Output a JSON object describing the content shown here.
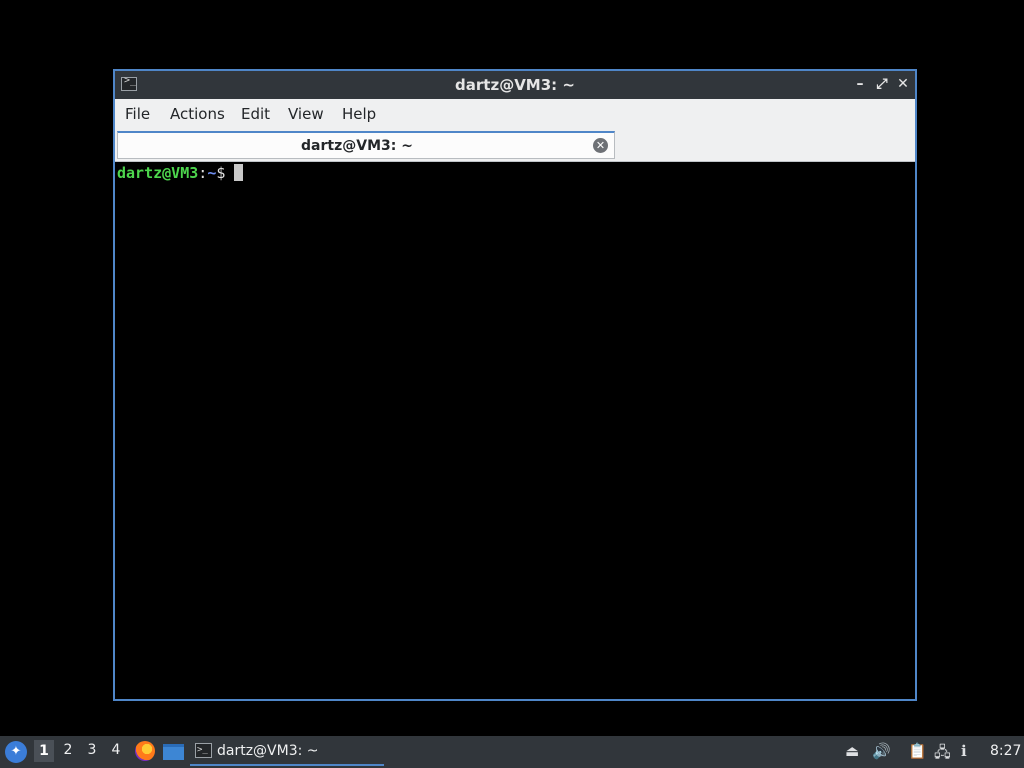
{
  "window": {
    "title": "dartz@VM3: ~",
    "controls": {
      "minimize": "–",
      "maximize": "⤢",
      "close": "✕"
    },
    "app_icon": "terminal-icon"
  },
  "menubar": {
    "items": [
      "File",
      "Actions",
      "Edit",
      "View",
      "Help"
    ]
  },
  "tab": {
    "label": "dartz@VM3: ~",
    "close_icon": "close-circle-icon"
  },
  "terminal": {
    "prompt_user": "dartz@VM3",
    "prompt_sep": ":",
    "prompt_path": "~",
    "prompt_symbol": "$"
  },
  "taskbar": {
    "launcher_icon": "lxqt-menu-icon",
    "workspaces": [
      "1",
      "2",
      "3",
      "4"
    ],
    "active_workspace": "1",
    "quicklaunch": [
      "firefox-icon",
      "file-manager-icon"
    ],
    "task_label": "dartz@VM3: ~",
    "tray_icons": [
      "removable-media-icon",
      "volume-icon",
      "clipboard-icon",
      "network-icon",
      "notification-icon"
    ],
    "clock": "8:27"
  },
  "colors": {
    "accent": "#4f86c8",
    "prompt_user": "#4dd64d",
    "prompt_path": "#6f8ef0",
    "panel": "#31363b"
  }
}
